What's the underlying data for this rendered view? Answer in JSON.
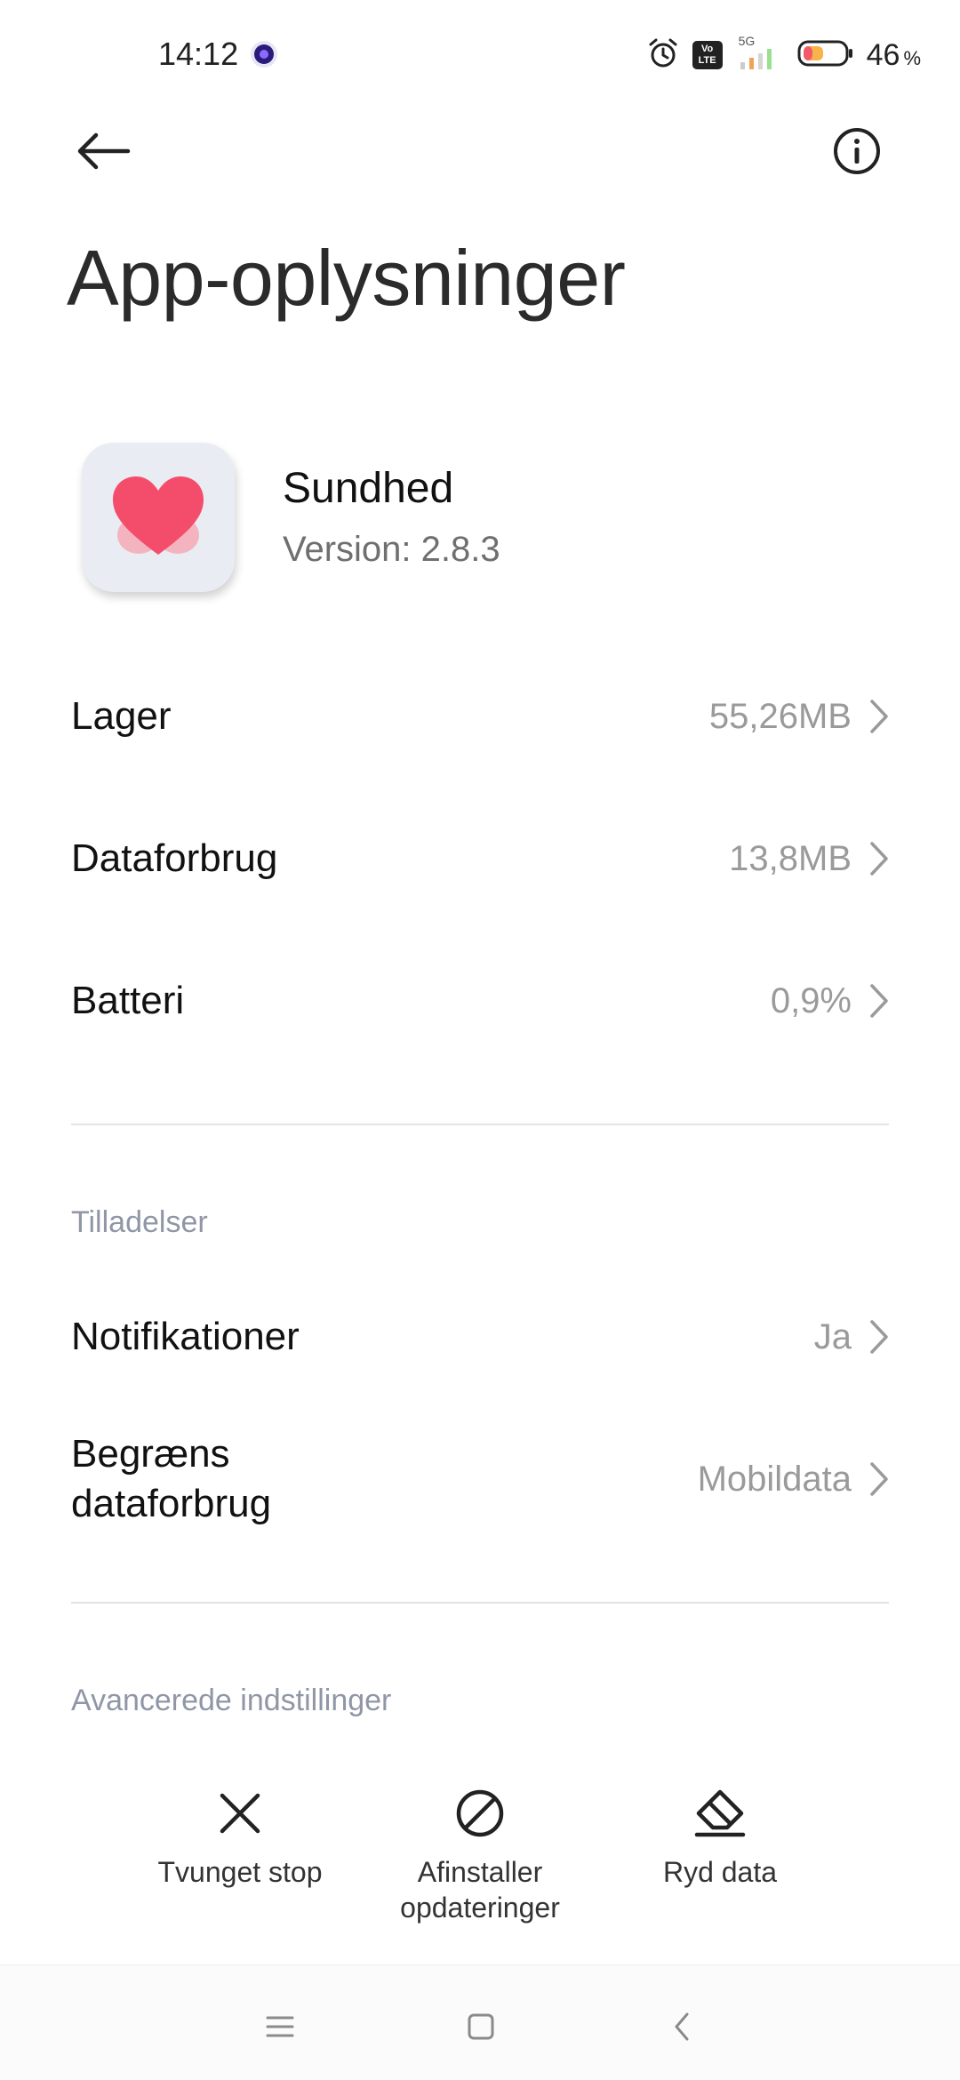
{
  "status_bar": {
    "time": "14:12",
    "battery_value": "46",
    "battery_unit": "%",
    "network_label": "5G",
    "volte_label": "Vo LTE"
  },
  "header": {
    "title": "App-oplysninger"
  },
  "app": {
    "name": "Sundhed",
    "version": "Version: 2.8.3",
    "icon": "heart-icon",
    "accent": "#f44d6b"
  },
  "usage_rows": [
    {
      "label": "Lager",
      "value": "55,26MB"
    },
    {
      "label": "Dataforbrug",
      "value": "13,8MB"
    },
    {
      "label": "Batteri",
      "value": "0,9%"
    }
  ],
  "permissions": {
    "header": "Tilladelser",
    "rows": [
      {
        "label": "Notifikationer",
        "value": "Ja"
      },
      {
        "label": "Begræns\ndataforbrug",
        "value": "Mobildata"
      }
    ]
  },
  "advanced": {
    "header": "Avancerede indstillinger",
    "actions": [
      {
        "label": "Tvunget stop",
        "icon": "close-icon"
      },
      {
        "label": "Afinstaller\nopdateringer",
        "icon": "block-icon"
      },
      {
        "label": "Ryd data",
        "icon": "eraser-icon"
      }
    ]
  },
  "nav": {
    "icons": [
      "menu-icon",
      "home-icon",
      "back-icon"
    ]
  }
}
